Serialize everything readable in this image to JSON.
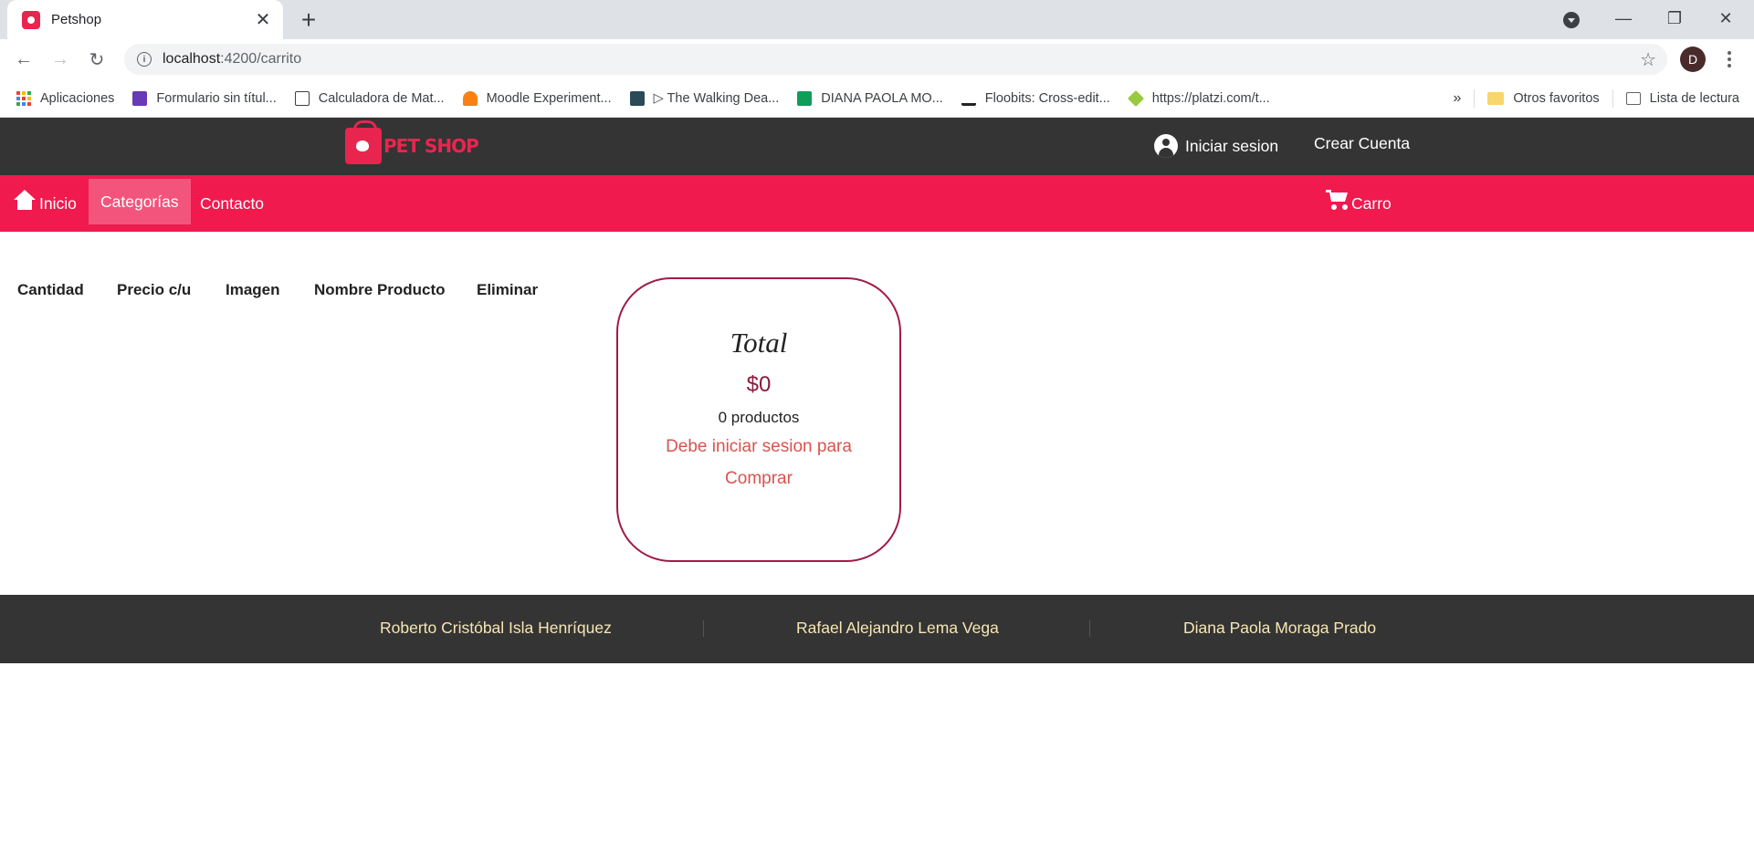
{
  "browser": {
    "tab_title": "Petshop",
    "url_host": "localhost",
    "url_path": ":4200/carrito",
    "profile_initial": "D",
    "bookmarks": [
      {
        "label": "Aplicaciones",
        "icon": "apps-grid-icon"
      },
      {
        "label": "Formulario sin títul...",
        "icon": "forms-icon",
        "color": "#673ab7"
      },
      {
        "label": "Calculadora de Mat...",
        "icon": "calculator-icon",
        "color": "#3c4043"
      },
      {
        "label": "Moodle Experiment...",
        "icon": "moodle-icon",
        "color": "#f98012"
      },
      {
        "label": "▷ The Walking Dea...",
        "icon": "walking-dead-icon",
        "color": "#2a4a5a"
      },
      {
        "label": "DIANA PAOLA MO...",
        "icon": "sheets-icon",
        "color": "#0f9d58"
      },
      {
        "label": "Floobits: Cross-edit...",
        "icon": "floobits-icon",
        "color": "#222222"
      },
      {
        "label": "https://platzi.com/t...",
        "icon": "platzi-icon",
        "color": "#98ca3f"
      }
    ],
    "overflow": "»",
    "other_favorites": "Otros favoritos",
    "reading_list": "Lista de lectura"
  },
  "header": {
    "logo_text": "PET SHOP",
    "login": "Iniciar sesion",
    "register": "Crear Cuenta"
  },
  "nav": {
    "home": "Inicio",
    "categories": "Categorías",
    "contact": "Contacto",
    "cart": "Carro"
  },
  "cart": {
    "columns": [
      "Cantidad",
      "Precio c/u",
      "Imagen",
      "Nombre Producto",
      "Eliminar"
    ],
    "total_title": "Total",
    "total_amount": "$0",
    "product_count": "0 productos",
    "message": "Debe iniciar sesion para Comprar"
  },
  "footer": {
    "authors": [
      "Roberto Cristóbal Isla Henríquez",
      "Rafael Alejandro Lema Vega",
      "Diana Paola Moraga Prado"
    ]
  },
  "colors": {
    "header_bg": "#343434",
    "nav_bg": "#f01a4f",
    "nav_active": "#f3547c",
    "card_border": "#a01a4a",
    "warning_text": "#d9534f",
    "footer_text": "#f7e6b4"
  }
}
